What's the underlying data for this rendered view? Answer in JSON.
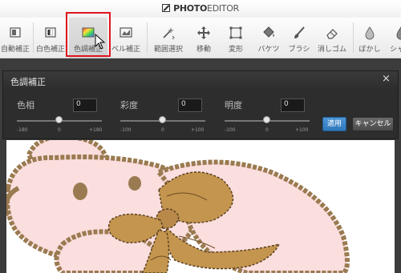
{
  "app": {
    "brand_bold": "PHOTO",
    "brand_light": "EDITOR"
  },
  "toolbar": {
    "tools": [
      {
        "label": "自動補正",
        "icon": "auto-adjust-icon"
      },
      {
        "label": "白色補正",
        "icon": "white-balance-icon"
      },
      {
        "label": "色調補正",
        "icon": "color-adjust-icon",
        "active": true
      },
      {
        "label": "ベル補正",
        "icon": "level-adjust-icon"
      },
      {
        "label": "範囲選択",
        "icon": "magic-wand-icon"
      },
      {
        "label": "移動",
        "icon": "move-icon"
      },
      {
        "label": "変形",
        "icon": "transform-icon"
      },
      {
        "label": "バケツ",
        "icon": "bucket-icon"
      },
      {
        "label": "ブラシ",
        "icon": "brush-icon"
      },
      {
        "label": "消しゴム",
        "icon": "eraser-icon"
      },
      {
        "label": "ぼかし",
        "icon": "blur-icon"
      },
      {
        "label": "シャ",
        "icon": "sharpen-icon"
      }
    ]
  },
  "dialog": {
    "title": "色調補正",
    "close_label": "×",
    "sliders": [
      {
        "label": "色相",
        "value": "0",
        "min": "-180",
        "mid": "0",
        "max": "+180",
        "position": 0.5
      },
      {
        "label": "彩度",
        "value": "0",
        "min": "-100",
        "mid": "0",
        "max": "+100",
        "position": 0.5
      },
      {
        "label": "明度",
        "value": "0",
        "min": "-100",
        "mid": "0",
        "max": "+100",
        "position": 0.5
      }
    ],
    "apply_label": "適用",
    "cancel_label": "キャンセル"
  },
  "colors": {
    "accent_blue": "#3a86c8",
    "highlight_red": "#e0141c",
    "bear_pink": "#fbdede",
    "ribbon_brown": "#c4954e",
    "outline_brown": "#9a7a50"
  }
}
